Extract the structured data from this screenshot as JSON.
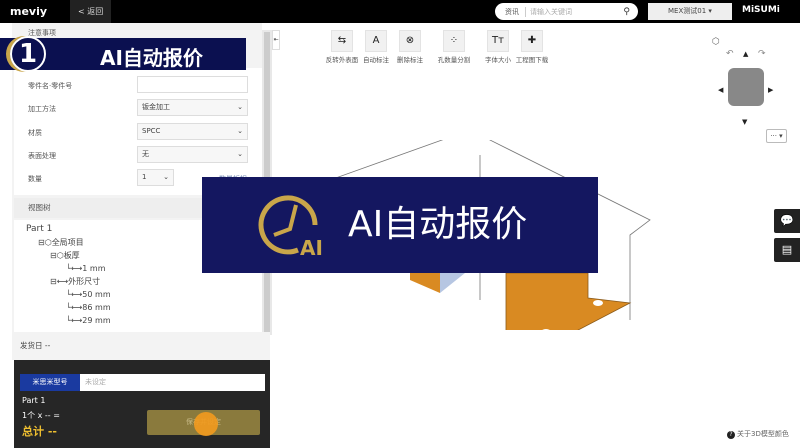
{
  "topbar": {
    "logo": "meviy",
    "back": "< 返回",
    "search_category": "资讯",
    "search_placeholder": "请输入关键词",
    "user": "MEX测试01",
    "brand": "MiSUMi"
  },
  "form": {
    "notice": "注意事项",
    "part_name_label": "零件名·零件号",
    "part_name_value": "",
    "method_label": "加工方法",
    "method_value": "钣金加工",
    "material_label": "材质",
    "material_value": "SPCC",
    "surface_label": "表面处理",
    "surface_value": "无",
    "qty_label": "数量",
    "qty_value": "1",
    "qty_discount": "数量折扣"
  },
  "tree": {
    "header": "视图树",
    "part": "Part 1",
    "global": "全局项目",
    "thickness": "板厚",
    "thickness_value": "1 mm",
    "outer": "外形尺寸",
    "x": "50 mm",
    "y": "86 mm",
    "z": "29 mm"
  },
  "footer": {
    "ship_date": "发货日 --",
    "model_tag": "米思米型号",
    "model_placeholder": "未设定",
    "part": "Part 1",
    "formula": "1个 x -- =",
    "total": "总计 --",
    "save": "保存并设定"
  },
  "toolbar": [
    {
      "icon": "flip-surface",
      "label": "反转外表面",
      "glyph": "⇆"
    },
    {
      "icon": "auto-dimension",
      "label": "自动标注",
      "glyph": "A"
    },
    {
      "icon": "delete-dimension",
      "label": "删除标注",
      "glyph": "⊗"
    },
    {
      "icon": "hole-split",
      "label": "孔数量分割",
      "glyph": "⁘"
    },
    {
      "icon": "font-size",
      "label": "字体大小",
      "glyph": "Tт"
    },
    {
      "icon": "drawing-download",
      "label": "工程图下载",
      "glyph": "✚"
    }
  ],
  "overlay": {
    "step": "1",
    "title": "AI自动报价",
    "main_title": "AI自动报价",
    "logo_text": "AI"
  },
  "viewer": {
    "more": "··· ▾",
    "about": "关于3D模型颜色"
  },
  "colors": {
    "banner": "#141760",
    "gold": "#c9a64a",
    "part": "#d98a22"
  }
}
